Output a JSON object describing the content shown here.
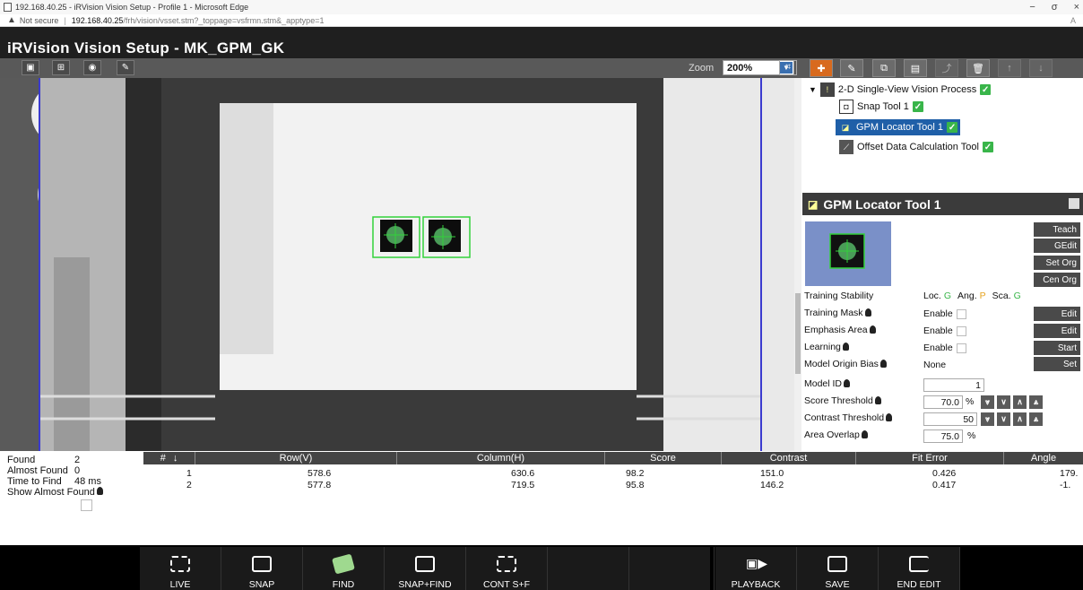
{
  "browser": {
    "title": "192.168.40.25 - iRVision Vision Setup - Profile 1 - Microsoft Edge",
    "not_secure": "Not secure",
    "url_host": "192.168.40.25",
    "url_path": "/frh/vision/vsset.stm?_toppage=vsfrmn.stm&_apptype=1",
    "minimize": "−",
    "restore": "σ",
    "close": "×",
    "reader": "A"
  },
  "app": {
    "title": "iRVision Vision Setup - MK_GPM_GK",
    "zoom_label": "Zoom",
    "zoom_value": "200%"
  },
  "tree": {
    "root": "2-D Single-View Vision Process",
    "children": [
      "Snap Tool 1",
      "GPM Locator Tool 1",
      "Offset Data Calculation Tool"
    ]
  },
  "tool": {
    "title": "GPM Locator Tool 1",
    "buttons": [
      "Teach",
      "GEdit",
      "Set Org",
      "Cen Org"
    ],
    "training_stability_label": "Training Stability",
    "stability": {
      "loc_label": "Loc.",
      "loc": "G",
      "ang_label": "Ang.",
      "ang": "P",
      "sca_label": "Sca.",
      "sca": "G"
    },
    "training_mask_label": "Training Mask",
    "training_mask_value": "Enable",
    "training_mask_btn": "Edit",
    "emphasis_area_label": "Emphasis Area",
    "emphasis_area_value": "Enable",
    "emphasis_area_btn": "Edit",
    "learning_label": "Learning",
    "learning_value": "Enable",
    "learning_btn": "Start",
    "model_origin_bias_label": "Model Origin Bias",
    "model_origin_bias_value": "None",
    "model_origin_bias_btn": "Set",
    "model_id_label": "Model ID",
    "model_id": "1",
    "score_threshold_label": "Score Threshold",
    "score_threshold": "70.0",
    "contrast_threshold_label": "Contrast Threshold",
    "contrast_threshold": "50",
    "area_overlap_label": "Area Overlap",
    "area_overlap": "75.0",
    "percent": "%"
  },
  "stats": {
    "found_label": "Found",
    "found": "2",
    "almost_found_label": "Almost Found",
    "almost_found": "0",
    "time_label": "Time to Find",
    "time": "48 ms",
    "show_almost_label": "Show Almost Found"
  },
  "table": {
    "headers": [
      "#",
      "Row(V)",
      "Column(H)",
      "Score",
      "Contrast",
      "Fit Error",
      "Angle"
    ],
    "rows": [
      [
        "1",
        "578.6",
        "630.6",
        "98.2",
        "151.0",
        "0.426",
        "179."
      ],
      [
        "2",
        "577.8",
        "719.5",
        "95.8",
        "146.2",
        "0.417",
        "-1."
      ]
    ]
  },
  "bottom": {
    "buttons": [
      "LIVE",
      "SNAP",
      "FIND",
      "SNAP+FIND",
      "CONT S+F",
      "",
      "",
      "PLAYBACK",
      "SAVE",
      "END EDIT"
    ]
  }
}
